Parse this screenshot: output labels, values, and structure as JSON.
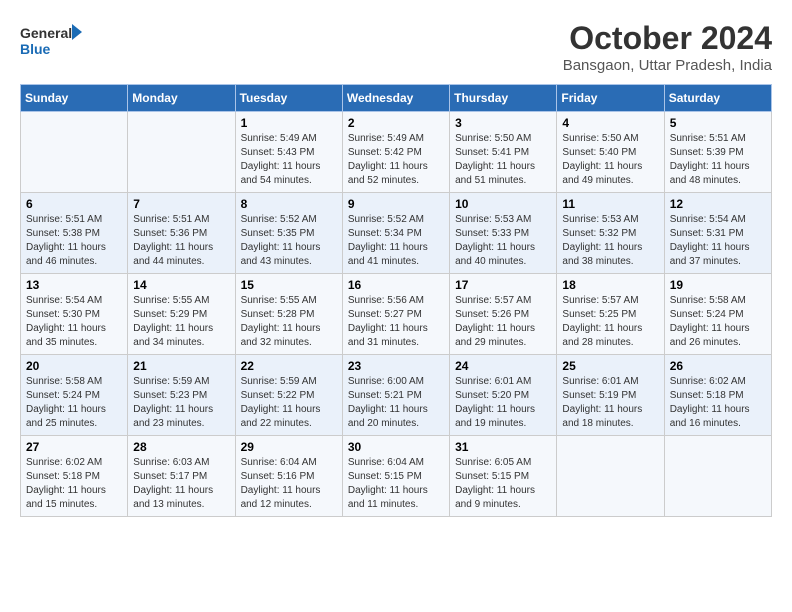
{
  "logo": {
    "line1": "General",
    "line2": "Blue"
  },
  "title": "October 2024",
  "subtitle": "Bansgaon, Uttar Pradesh, India",
  "days_of_week": [
    "Sunday",
    "Monday",
    "Tuesday",
    "Wednesday",
    "Thursday",
    "Friday",
    "Saturday"
  ],
  "weeks": [
    [
      {
        "day": "",
        "info": ""
      },
      {
        "day": "",
        "info": ""
      },
      {
        "day": "1",
        "sunrise": "Sunrise: 5:49 AM",
        "sunset": "Sunset: 5:43 PM",
        "daylight": "Daylight: 11 hours and 54 minutes."
      },
      {
        "day": "2",
        "sunrise": "Sunrise: 5:49 AM",
        "sunset": "Sunset: 5:42 PM",
        "daylight": "Daylight: 11 hours and 52 minutes."
      },
      {
        "day": "3",
        "sunrise": "Sunrise: 5:50 AM",
        "sunset": "Sunset: 5:41 PM",
        "daylight": "Daylight: 11 hours and 51 minutes."
      },
      {
        "day": "4",
        "sunrise": "Sunrise: 5:50 AM",
        "sunset": "Sunset: 5:40 PM",
        "daylight": "Daylight: 11 hours and 49 minutes."
      },
      {
        "day": "5",
        "sunrise": "Sunrise: 5:51 AM",
        "sunset": "Sunset: 5:39 PM",
        "daylight": "Daylight: 11 hours and 48 minutes."
      }
    ],
    [
      {
        "day": "6",
        "sunrise": "Sunrise: 5:51 AM",
        "sunset": "Sunset: 5:38 PM",
        "daylight": "Daylight: 11 hours and 46 minutes."
      },
      {
        "day": "7",
        "sunrise": "Sunrise: 5:51 AM",
        "sunset": "Sunset: 5:36 PM",
        "daylight": "Daylight: 11 hours and 44 minutes."
      },
      {
        "day": "8",
        "sunrise": "Sunrise: 5:52 AM",
        "sunset": "Sunset: 5:35 PM",
        "daylight": "Daylight: 11 hours and 43 minutes."
      },
      {
        "day": "9",
        "sunrise": "Sunrise: 5:52 AM",
        "sunset": "Sunset: 5:34 PM",
        "daylight": "Daylight: 11 hours and 41 minutes."
      },
      {
        "day": "10",
        "sunrise": "Sunrise: 5:53 AM",
        "sunset": "Sunset: 5:33 PM",
        "daylight": "Daylight: 11 hours and 40 minutes."
      },
      {
        "day": "11",
        "sunrise": "Sunrise: 5:53 AM",
        "sunset": "Sunset: 5:32 PM",
        "daylight": "Daylight: 11 hours and 38 minutes."
      },
      {
        "day": "12",
        "sunrise": "Sunrise: 5:54 AM",
        "sunset": "Sunset: 5:31 PM",
        "daylight": "Daylight: 11 hours and 37 minutes."
      }
    ],
    [
      {
        "day": "13",
        "sunrise": "Sunrise: 5:54 AM",
        "sunset": "Sunset: 5:30 PM",
        "daylight": "Daylight: 11 hours and 35 minutes."
      },
      {
        "day": "14",
        "sunrise": "Sunrise: 5:55 AM",
        "sunset": "Sunset: 5:29 PM",
        "daylight": "Daylight: 11 hours and 34 minutes."
      },
      {
        "day": "15",
        "sunrise": "Sunrise: 5:55 AM",
        "sunset": "Sunset: 5:28 PM",
        "daylight": "Daylight: 11 hours and 32 minutes."
      },
      {
        "day": "16",
        "sunrise": "Sunrise: 5:56 AM",
        "sunset": "Sunset: 5:27 PM",
        "daylight": "Daylight: 11 hours and 31 minutes."
      },
      {
        "day": "17",
        "sunrise": "Sunrise: 5:57 AM",
        "sunset": "Sunset: 5:26 PM",
        "daylight": "Daylight: 11 hours and 29 minutes."
      },
      {
        "day": "18",
        "sunrise": "Sunrise: 5:57 AM",
        "sunset": "Sunset: 5:25 PM",
        "daylight": "Daylight: 11 hours and 28 minutes."
      },
      {
        "day": "19",
        "sunrise": "Sunrise: 5:58 AM",
        "sunset": "Sunset: 5:24 PM",
        "daylight": "Daylight: 11 hours and 26 minutes."
      }
    ],
    [
      {
        "day": "20",
        "sunrise": "Sunrise: 5:58 AM",
        "sunset": "Sunset: 5:24 PM",
        "daylight": "Daylight: 11 hours and 25 minutes."
      },
      {
        "day": "21",
        "sunrise": "Sunrise: 5:59 AM",
        "sunset": "Sunset: 5:23 PM",
        "daylight": "Daylight: 11 hours and 23 minutes."
      },
      {
        "day": "22",
        "sunrise": "Sunrise: 5:59 AM",
        "sunset": "Sunset: 5:22 PM",
        "daylight": "Daylight: 11 hours and 22 minutes."
      },
      {
        "day": "23",
        "sunrise": "Sunrise: 6:00 AM",
        "sunset": "Sunset: 5:21 PM",
        "daylight": "Daylight: 11 hours and 20 minutes."
      },
      {
        "day": "24",
        "sunrise": "Sunrise: 6:01 AM",
        "sunset": "Sunset: 5:20 PM",
        "daylight": "Daylight: 11 hours and 19 minutes."
      },
      {
        "day": "25",
        "sunrise": "Sunrise: 6:01 AM",
        "sunset": "Sunset: 5:19 PM",
        "daylight": "Daylight: 11 hours and 18 minutes."
      },
      {
        "day": "26",
        "sunrise": "Sunrise: 6:02 AM",
        "sunset": "Sunset: 5:18 PM",
        "daylight": "Daylight: 11 hours and 16 minutes."
      }
    ],
    [
      {
        "day": "27",
        "sunrise": "Sunrise: 6:02 AM",
        "sunset": "Sunset: 5:18 PM",
        "daylight": "Daylight: 11 hours and 15 minutes."
      },
      {
        "day": "28",
        "sunrise": "Sunrise: 6:03 AM",
        "sunset": "Sunset: 5:17 PM",
        "daylight": "Daylight: 11 hours and 13 minutes."
      },
      {
        "day": "29",
        "sunrise": "Sunrise: 6:04 AM",
        "sunset": "Sunset: 5:16 PM",
        "daylight": "Daylight: 11 hours and 12 minutes."
      },
      {
        "day": "30",
        "sunrise": "Sunrise: 6:04 AM",
        "sunset": "Sunset: 5:15 PM",
        "daylight": "Daylight: 11 hours and 11 minutes."
      },
      {
        "day": "31",
        "sunrise": "Sunrise: 6:05 AM",
        "sunset": "Sunset: 5:15 PM",
        "daylight": "Daylight: 11 hours and 9 minutes."
      },
      {
        "day": "",
        "info": ""
      },
      {
        "day": "",
        "info": ""
      }
    ]
  ]
}
